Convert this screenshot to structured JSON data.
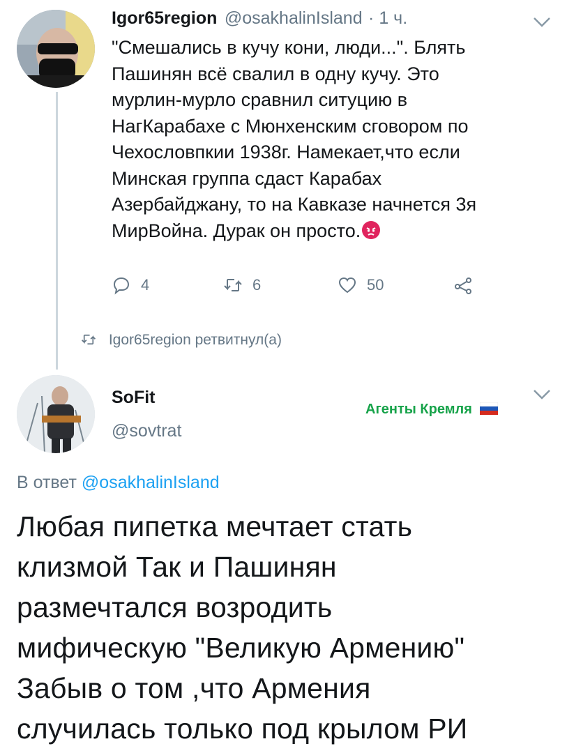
{
  "tweet1": {
    "display_name": "Igor65region",
    "handle": "@osakhalinIsland",
    "time": "· 1 ч.",
    "text_lines": [
      "\"Смешались в кучу кони, люди...\". Блять",
      "Пашинян всё свалил в одну кучу. Это",
      "мурлин-мурло сравнил ситуцию в",
      "НагКарабахе с Мюнхенским сговором по",
      "Чехословпкии 1938г. Намекает,что если",
      "Минская группа сдаст Карабах",
      "Азербайджану, то на Кавказе начнется 3я",
      "МирВойна. Дурак он просто."
    ],
    "actions": {
      "reply_count": "4",
      "retweet_count": "6",
      "like_count": "50"
    }
  },
  "retweet_notice": "Igor65region ретвитнул(а)",
  "tweet2": {
    "display_name": "SoFit",
    "handle": "@sovtrat",
    "label": "Агенты Кремля",
    "reply_prefix": "В ответ",
    "reply_to": "@osakhalinIsland",
    "text_lines": [
      "Любая пипетка мечтает стать",
      "клизмой Так и Пашинян",
      "размечтался возродить",
      "мифическую \"Великую Армению\"",
      "Забыв о том ,что Армения",
      "случилась только под крылом РИ"
    ]
  },
  "icons": {
    "reply": "reply-icon",
    "retweet": "retweet-icon",
    "like": "heart-icon",
    "share": "share-icon",
    "emoji": "angry-face-emoji",
    "flag": "russia-flag-emoji"
  },
  "colors": {
    "text": "#14171a",
    "secondary": "#657786",
    "link": "#1da1f2",
    "label_green": "#17a34a"
  }
}
